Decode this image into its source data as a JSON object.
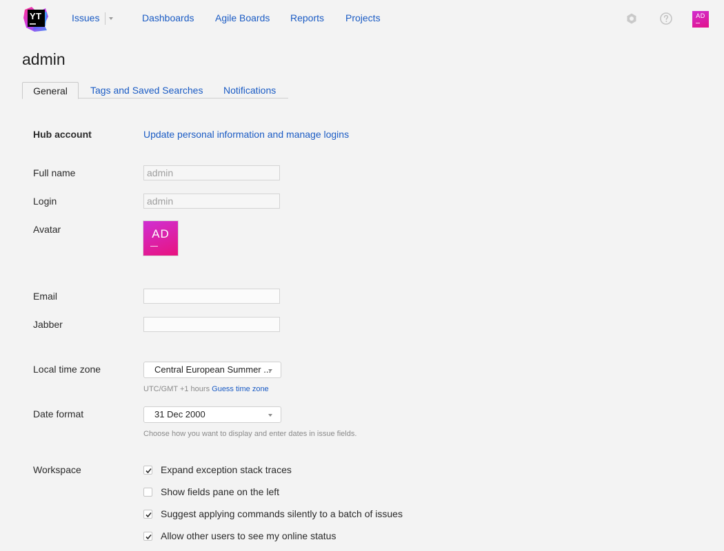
{
  "header": {
    "logo_text": "YT",
    "nav": [
      "Issues",
      "Dashboards",
      "Agile Boards",
      "Reports",
      "Projects"
    ],
    "user_initials": "AD"
  },
  "page": {
    "title": "admin"
  },
  "tabs": [
    "General",
    "Tags and Saved Searches",
    "Notifications"
  ],
  "form": {
    "hub_account_label": "Hub account",
    "hub_account_link": "Update personal information and manage logins",
    "full_name_label": "Full name",
    "full_name_value": "admin",
    "login_label": "Login",
    "login_value": "admin",
    "avatar_label": "Avatar",
    "avatar_initials": "AD",
    "email_label": "Email",
    "email_value": "",
    "jabber_label": "Jabber",
    "jabber_value": "",
    "timezone_label": "Local time zone",
    "timezone_value": "Central European Summer ...",
    "timezone_hint": "UTC/GMT +1 hours",
    "timezone_hint_link": "Guess time zone",
    "date_format_label": "Date format",
    "date_format_value": "31 Dec 2000",
    "date_format_hint": "Choose how you want to display and enter dates in issue fields.",
    "workspace_label": "Workspace",
    "workspace_options": [
      {
        "label": "Expand exception stack traces",
        "checked": true
      },
      {
        "label": "Show fields pane on the left",
        "checked": false
      },
      {
        "label": "Suggest applying commands silently to a batch of issues",
        "checked": true
      },
      {
        "label": "Allow other users to see my online status",
        "checked": true
      }
    ]
  },
  "colors": {
    "accent": "#1a5bc4",
    "background": "#f3f3f3",
    "avatar_gradient_start": "#cf2fd2",
    "avatar_gradient_end": "#e8137f"
  },
  "icons": {
    "logo": "youtrack-logo",
    "settings": "gear-icon",
    "help": "help-circle-icon",
    "nav_dropdown": "chevron-down-icon",
    "select_dropdown": "chevron-down-icon",
    "checked": "checkmark-icon"
  }
}
